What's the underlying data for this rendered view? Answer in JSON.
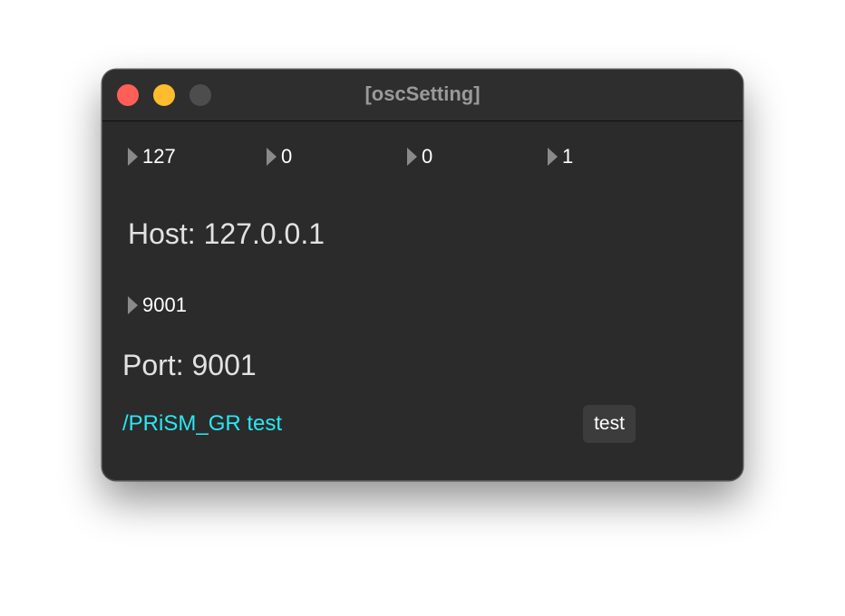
{
  "window": {
    "title": "[oscSetting]"
  },
  "ip_octets": [
    {
      "value": "127"
    },
    {
      "value": "0"
    },
    {
      "value": "0"
    },
    {
      "value": "1"
    }
  ],
  "host_label": "Host: 127.0.0.1",
  "port_numbox": "9001",
  "port_label": "Port: 9001",
  "message_text": "/PRiSM_GR test",
  "test_button_label": "test",
  "colors": {
    "background": "#2b2b2b",
    "message_text": "#29e7f2",
    "close": "#ff5f57",
    "minimize": "#febc2e",
    "zoom_inactive": "#4d4d4d"
  }
}
